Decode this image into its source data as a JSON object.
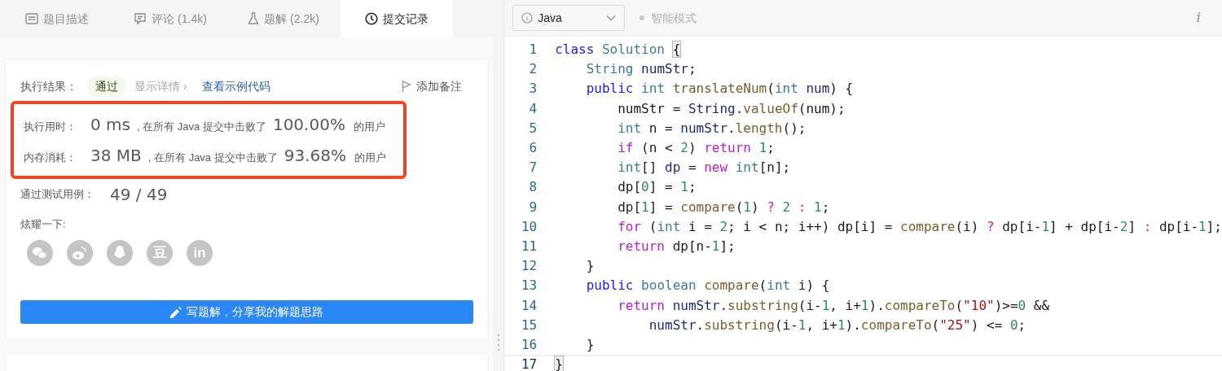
{
  "tabs": [
    {
      "label": "题目描述",
      "selected": false
    },
    {
      "label": "评论 (1.4k)",
      "selected": false
    },
    {
      "label": "题解 (2.2k)",
      "selected": false
    },
    {
      "label": "提交记录",
      "selected": true
    }
  ],
  "result": {
    "label": "执行结果：",
    "status": "通过",
    "details": "显示详情 ›",
    "link": "查看示例代码",
    "note": "添加备注"
  },
  "stats": {
    "highlighted": true,
    "rows": [
      {
        "label": "执行用时：",
        "value": "0 ms",
        "middle": ", 在所有 Java 提交中击败了",
        "percent": "100.00%",
        "suffix": "的用户"
      },
      {
        "label": "内存消耗：",
        "value": "38 MB",
        "middle": ", 在所有 Java 提交中击败了",
        "percent": "93.68%",
        "suffix": "的用户"
      }
    ]
  },
  "tests": {
    "label": "通过测试用例：",
    "value": "49 / 49"
  },
  "share": {
    "label": "炫耀一下:",
    "items": [
      {
        "kind": "chat"
      },
      {
        "kind": "swirl"
      },
      {
        "kind": "penguin"
      },
      {
        "kind": "glyph",
        "text": "豆"
      },
      {
        "kind": "glyph",
        "text": "in"
      }
    ]
  },
  "write_button": "写题解，分享我的解题思路",
  "editor": {
    "language": "Java",
    "mode": "智能模式",
    "info": "i",
    "lines": [
      {
        "number": "1",
        "current": false,
        "tokens": [
          {
            "kind": "keyword",
            "text": "class "
          },
          {
            "kind": "type",
            "text": "Solution "
          },
          {
            "kind": "bracket",
            "text": "{"
          }
        ]
      },
      {
        "number": "2",
        "current": false,
        "tokens": [
          {
            "kind": "type",
            "text": "    String "
          },
          {
            "kind": "var",
            "text": "numStr"
          },
          {
            "kind": "plain",
            "text": ";"
          }
        ]
      },
      {
        "number": "3",
        "current": false,
        "tokens": [
          {
            "kind": "keyword",
            "text": "    public "
          },
          {
            "kind": "type",
            "text": "int "
          },
          {
            "kind": "func",
            "text": "translateNum"
          },
          {
            "kind": "plain",
            "text": "("
          },
          {
            "kind": "type",
            "text": "int "
          },
          {
            "kind": "var",
            "text": "num"
          },
          {
            "kind": "plain",
            "text": ") {"
          }
        ]
      },
      {
        "number": "4",
        "current": false,
        "tokens": [
          {
            "kind": "plain",
            "text": "        numStr = "
          },
          {
            "kind": "var",
            "text": "String"
          },
          {
            "kind": "plain",
            "text": "."
          },
          {
            "kind": "func",
            "text": "valueOf"
          },
          {
            "kind": "plain",
            "text": "(num);"
          }
        ]
      },
      {
        "number": "5",
        "current": false,
        "tokens": [
          {
            "kind": "type",
            "text": "        int "
          },
          {
            "kind": "plain",
            "text": "n = "
          },
          {
            "kind": "var",
            "text": "numStr"
          },
          {
            "kind": "plain",
            "text": "."
          },
          {
            "kind": "func",
            "text": "length"
          },
          {
            "kind": "plain",
            "text": "();"
          }
        ]
      },
      {
        "number": "6",
        "current": false,
        "tokens": [
          {
            "kind": "control",
            "text": "        if "
          },
          {
            "kind": "plain",
            "text": "(n < "
          },
          {
            "kind": "number",
            "text": "2"
          },
          {
            "kind": "plain",
            "text": ") "
          },
          {
            "kind": "control",
            "text": "return "
          },
          {
            "kind": "number",
            "text": "1"
          },
          {
            "kind": "plain",
            "text": ";"
          }
        ]
      },
      {
        "number": "7",
        "current": false,
        "tokens": [
          {
            "kind": "type",
            "text": "        int"
          },
          {
            "kind": "plain",
            "text": "[] "
          },
          {
            "kind": "var",
            "text": "dp"
          },
          {
            "kind": "plain",
            "text": " = "
          },
          {
            "kind": "control",
            "text": "new "
          },
          {
            "kind": "type",
            "text": "int"
          },
          {
            "kind": "plain",
            "text": "[n];"
          }
        ]
      },
      {
        "number": "8",
        "current": false,
        "tokens": [
          {
            "kind": "plain",
            "text": "        dp["
          },
          {
            "kind": "number",
            "text": "0"
          },
          {
            "kind": "plain",
            "text": "] = "
          },
          {
            "kind": "number",
            "text": "1"
          },
          {
            "kind": "plain",
            "text": ";"
          }
        ]
      },
      {
        "number": "9",
        "current": false,
        "tokens": [
          {
            "kind": "plain",
            "text": "        dp["
          },
          {
            "kind": "number",
            "text": "1"
          },
          {
            "kind": "plain",
            "text": "] = "
          },
          {
            "kind": "func",
            "text": "compare"
          },
          {
            "kind": "plain",
            "text": "("
          },
          {
            "kind": "number",
            "text": "1"
          },
          {
            "kind": "plain",
            "text": ") "
          },
          {
            "kind": "control",
            "text": "? "
          },
          {
            "kind": "number",
            "text": "2 "
          },
          {
            "kind": "control",
            "text": ": "
          },
          {
            "kind": "number",
            "text": "1"
          },
          {
            "kind": "plain",
            "text": ";"
          }
        ]
      },
      {
        "number": "10",
        "current": false,
        "tokens": [
          {
            "kind": "control",
            "text": "        for "
          },
          {
            "kind": "plain",
            "text": "("
          },
          {
            "kind": "type",
            "text": "int "
          },
          {
            "kind": "plain",
            "text": "i = "
          },
          {
            "kind": "number",
            "text": "2"
          },
          {
            "kind": "plain",
            "text": "; i < n; i++) dp[i] = "
          },
          {
            "kind": "func",
            "text": "compare"
          },
          {
            "kind": "plain",
            "text": "(i) "
          },
          {
            "kind": "control",
            "text": "? "
          },
          {
            "kind": "plain",
            "text": "dp[i-"
          },
          {
            "kind": "number",
            "text": "1"
          },
          {
            "kind": "plain",
            "text": "] + dp[i-"
          },
          {
            "kind": "number",
            "text": "2"
          },
          {
            "kind": "plain",
            "text": "] "
          },
          {
            "kind": "control",
            "text": ": "
          },
          {
            "kind": "plain",
            "text": "dp[i-"
          },
          {
            "kind": "number",
            "text": "1"
          },
          {
            "kind": "plain",
            "text": "];"
          }
        ]
      },
      {
        "number": "11",
        "current": false,
        "tokens": [
          {
            "kind": "control",
            "text": "        return "
          },
          {
            "kind": "plain",
            "text": "dp[n-"
          },
          {
            "kind": "number",
            "text": "1"
          },
          {
            "kind": "plain",
            "text": "];"
          }
        ]
      },
      {
        "number": "12",
        "current": false,
        "tokens": [
          {
            "kind": "plain",
            "text": "    }"
          }
        ]
      },
      {
        "number": "13",
        "current": false,
        "tokens": [
          {
            "kind": "keyword",
            "text": "    public "
          },
          {
            "kind": "type",
            "text": "boolean "
          },
          {
            "kind": "func",
            "text": "compare"
          },
          {
            "kind": "plain",
            "text": "("
          },
          {
            "kind": "type",
            "text": "int "
          },
          {
            "kind": "var",
            "text": "i"
          },
          {
            "kind": "plain",
            "text": ") {"
          }
        ]
      },
      {
        "number": "14",
        "current": false,
        "tokens": [
          {
            "kind": "control",
            "text": "        return "
          },
          {
            "kind": "var",
            "text": "numStr"
          },
          {
            "kind": "plain",
            "text": "."
          },
          {
            "kind": "func",
            "text": "substring"
          },
          {
            "kind": "plain",
            "text": "(i-"
          },
          {
            "kind": "number",
            "text": "1"
          },
          {
            "kind": "plain",
            "text": ", i+"
          },
          {
            "kind": "number",
            "text": "1"
          },
          {
            "kind": "plain",
            "text": ")."
          },
          {
            "kind": "func",
            "text": "compareTo"
          },
          {
            "kind": "plain",
            "text": "("
          },
          {
            "kind": "string",
            "text": "\"10\""
          },
          {
            "kind": "plain",
            "text": ")>="
          },
          {
            "kind": "number",
            "text": "0"
          },
          {
            "kind": "plain",
            "text": " &&"
          }
        ]
      },
      {
        "number": "15",
        "current": false,
        "tokens": [
          {
            "kind": "var",
            "text": "            numStr"
          },
          {
            "kind": "plain",
            "text": "."
          },
          {
            "kind": "func",
            "text": "substring"
          },
          {
            "kind": "plain",
            "text": "(i-"
          },
          {
            "kind": "number",
            "text": "1"
          },
          {
            "kind": "plain",
            "text": ", i+"
          },
          {
            "kind": "number",
            "text": "1"
          },
          {
            "kind": "plain",
            "text": ")."
          },
          {
            "kind": "func",
            "text": "compareTo"
          },
          {
            "kind": "plain",
            "text": "("
          },
          {
            "kind": "string",
            "text": "\"25\""
          },
          {
            "kind": "plain",
            "text": ") <= "
          },
          {
            "kind": "number",
            "text": "0"
          },
          {
            "kind": "plain",
            "text": ";"
          }
        ]
      },
      {
        "number": "16",
        "current": false,
        "tokens": [
          {
            "kind": "plain",
            "text": "    }"
          }
        ]
      },
      {
        "number": "17",
        "current": true,
        "tokens": [
          {
            "kind": "bracket",
            "text": "}"
          }
        ]
      }
    ]
  }
}
